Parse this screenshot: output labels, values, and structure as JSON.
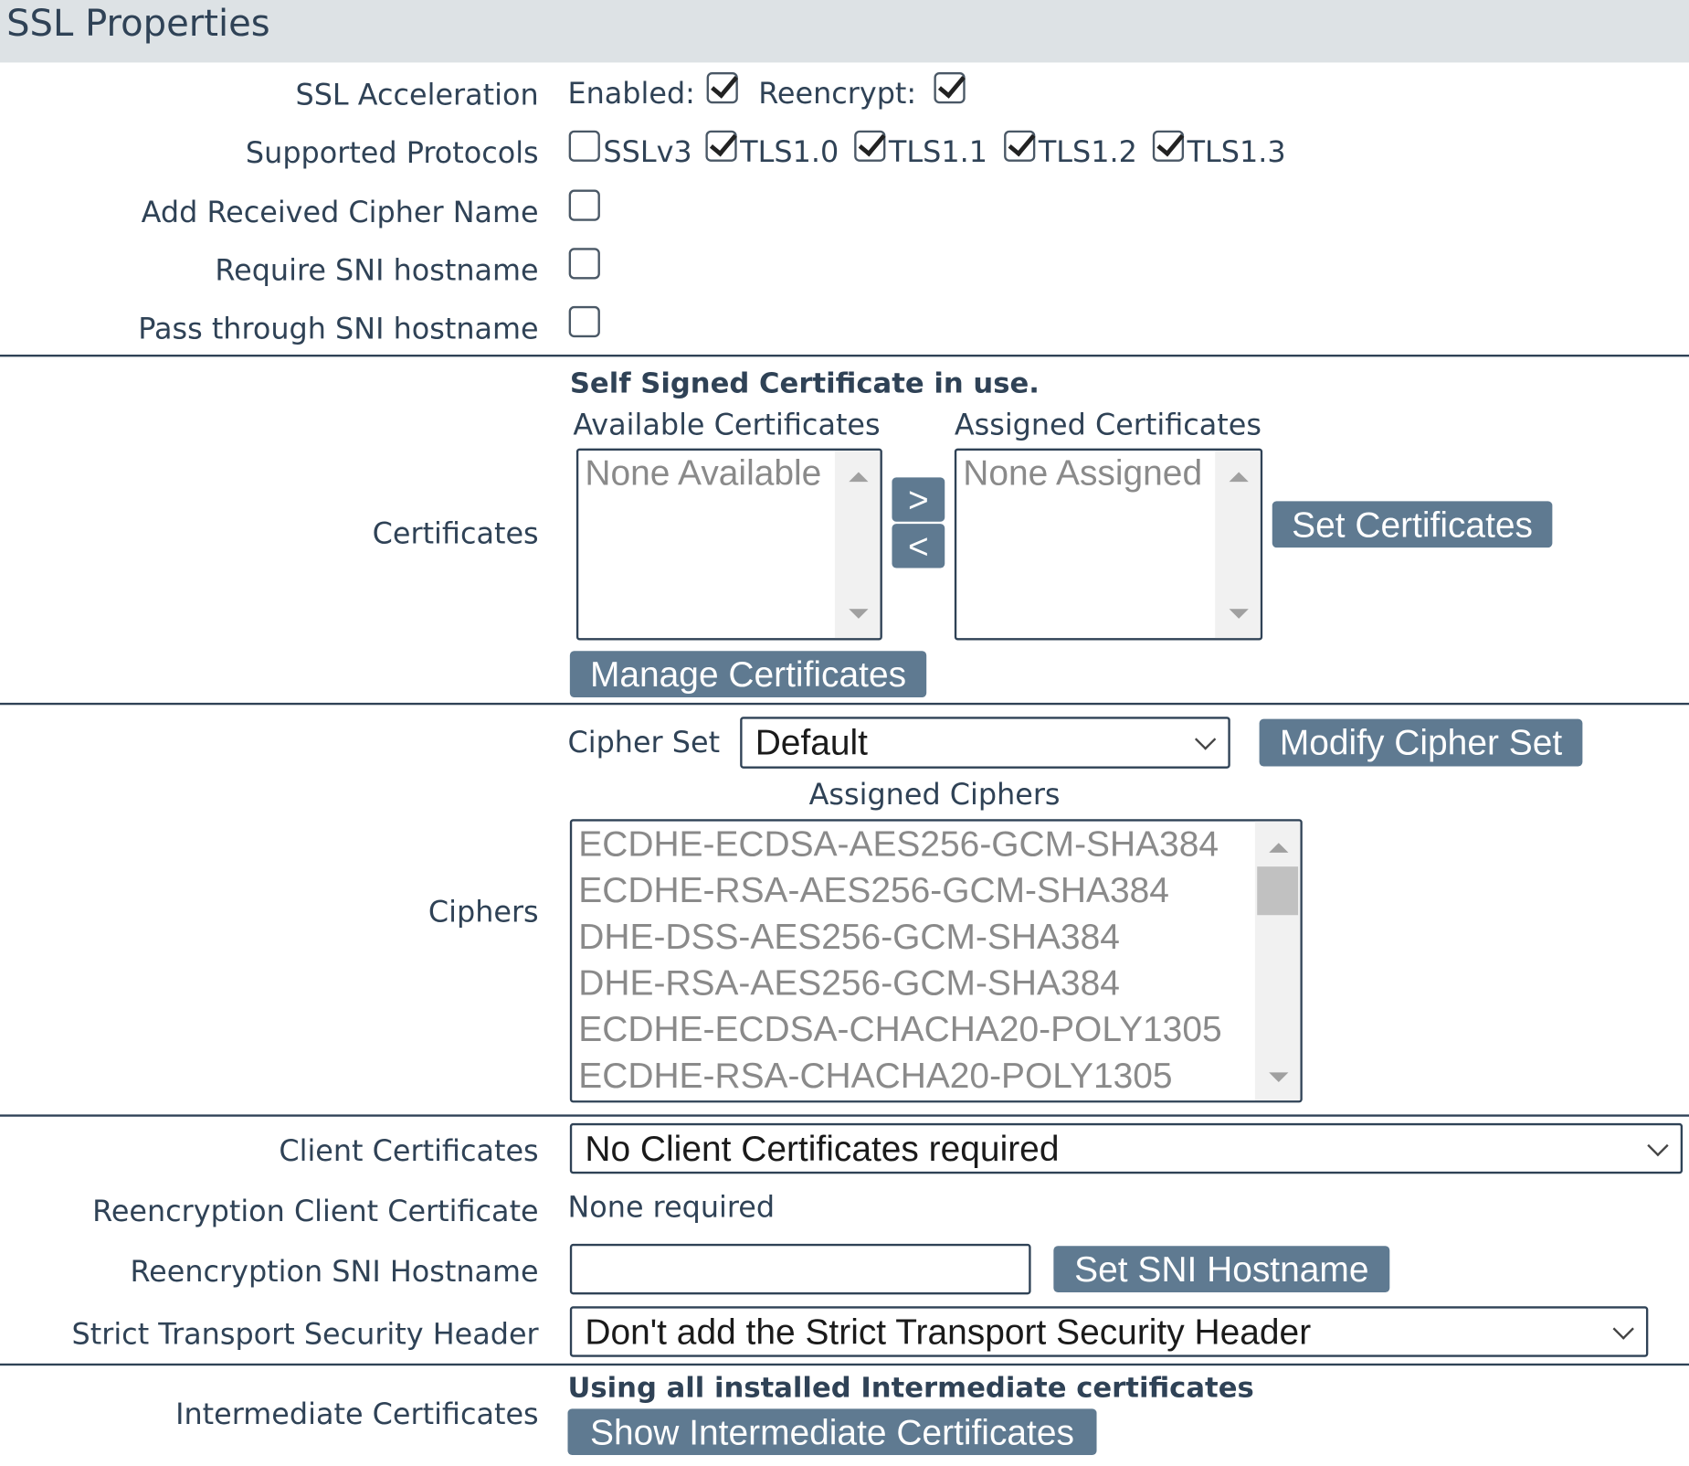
{
  "header": {
    "title": "SSL Properties"
  },
  "ssl_acceleration": {
    "label": "SSL Acceleration",
    "enabled_label": "Enabled:",
    "enabled": true,
    "reencrypt_label": "Reencrypt:",
    "reencrypt": true
  },
  "protocols": {
    "label": "Supported Protocols",
    "items": [
      {
        "name": "SSLv3",
        "checked": false
      },
      {
        "name": "TLS1.0",
        "checked": true
      },
      {
        "name": "TLS1.1",
        "checked": true
      },
      {
        "name": "TLS1.2",
        "checked": true
      },
      {
        "name": "TLS1.3",
        "checked": true
      }
    ]
  },
  "add_cipher_name": {
    "label": "Add Received Cipher Name",
    "checked": false
  },
  "require_sni": {
    "label": "Require SNI hostname",
    "checked": false
  },
  "pass_sni": {
    "label": "Pass through SNI hostname",
    "checked": false
  },
  "certificates": {
    "label": "Certificates",
    "status": "Self Signed Certificate in use.",
    "available_label": "Available Certificates",
    "available_items": [
      "None Available"
    ],
    "assigned_label": "Assigned Certificates",
    "assigned_items": [
      "None Assigned"
    ],
    "add_button": ">",
    "remove_button": "<",
    "set_button": "Set Certificates",
    "manage_button": "Manage Certificates"
  },
  "ciphers": {
    "label": "Ciphers",
    "cipher_set_label": "Cipher Set",
    "cipher_set_value": "Default",
    "modify_button": "Modify Cipher Set",
    "assigned_label": "Assigned Ciphers",
    "assigned_items": [
      "ECDHE-ECDSA-AES256-GCM-SHA384",
      "ECDHE-RSA-AES256-GCM-SHA384",
      "DHE-DSS-AES256-GCM-SHA384",
      "DHE-RSA-AES256-GCM-SHA384",
      "ECDHE-ECDSA-CHACHA20-POLY1305",
      "ECDHE-RSA-CHACHA20-POLY1305"
    ]
  },
  "client_certificates": {
    "label": "Client Certificates",
    "value": "No Client Certificates required"
  },
  "reencryption_client_cert": {
    "label": "Reencryption Client Certificate",
    "value": "None required"
  },
  "reencryption_sni": {
    "label": "Reencryption SNI Hostname",
    "value": "",
    "button": "Set SNI Hostname"
  },
  "hsts": {
    "label": "Strict Transport Security Header",
    "value": "Don't add the Strict Transport Security Header"
  },
  "intermediate": {
    "label": "Intermediate Certificates",
    "status": "Using all installed Intermediate certificates",
    "button": "Show Intermediate Certificates"
  }
}
